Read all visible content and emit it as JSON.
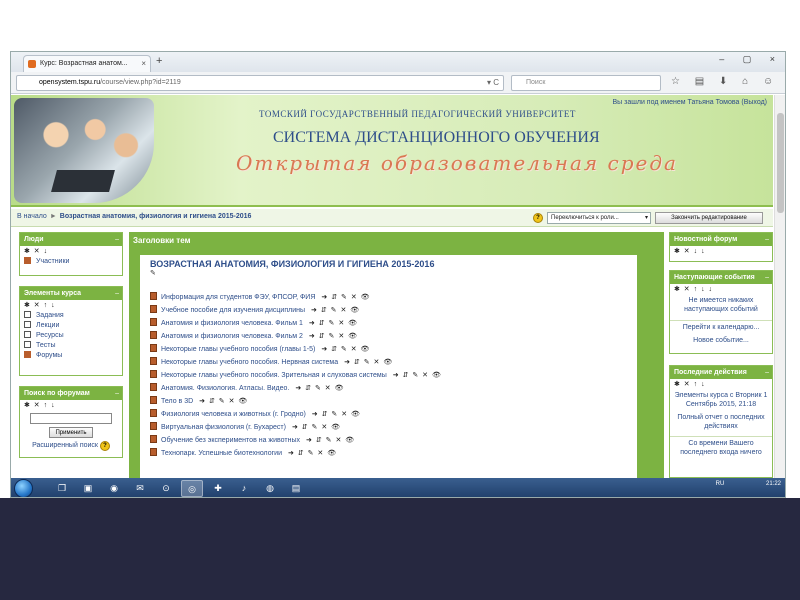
{
  "browser": {
    "tab_title": "Курс: Возрастная анатом...",
    "tab_close": "×",
    "new_tab": "+",
    "window_controls": "– ▢ ×",
    "url_host": "opensystem.tspu.ru",
    "url_path": "/course/view.php?id=2119",
    "url_controls": "▾ C",
    "search_placeholder": "Поиск",
    "toolbar_icons": "☆ ▤ ⬇ ⌂ ☺ ≡"
  },
  "header": {
    "university": "ТОМСКИЙ ГОСУДАРСТВЕННЫЙ ПЕДАГОГИЧЕСКИЙ УНИВЕРСИТЕТ",
    "system": "СИСТЕМА ДИСТАНЦИОННОГО ОБУЧЕНИЯ",
    "slogan": "Открытая образовательная среда",
    "login_prefix": "Вы зашли под именем",
    "user_name": "Татьяна Томова",
    "logout": "(Выход)"
  },
  "breadcrumb": {
    "home": "В начало",
    "separator": "►",
    "current": "Возрастная анатомия, физиология и гигиена 2015-2016"
  },
  "toolbar": {
    "help": "?",
    "role_select": "Переключиться к роли...",
    "role_arrow": "▾",
    "edit_button": "Закончить редактирование"
  },
  "left": {
    "people": {
      "title": "Люди",
      "collapse": "–",
      "controls": "✱ ✕ ↓",
      "items": [
        "Участники"
      ]
    },
    "elements": {
      "title": "Элементы курса",
      "collapse": "–",
      "controls": "✱ ✕ ↑ ↓",
      "items": [
        "Задания",
        "Лекции",
        "Ресурсы",
        "Тесты",
        "Форумы"
      ]
    },
    "forum_search": {
      "title": "Поиск по форумам",
      "collapse": "–",
      "controls": "✱ ✕ ↑ ↓",
      "button": "Применить",
      "advanced": "Расширенный поиск"
    }
  },
  "center": {
    "header": "Заголовки тем",
    "course_title": "ВОЗРАСТНАЯ АНАТОМИЯ, ФИЗИОЛОГИЯ И ГИГИЕНА 2015-2016",
    "edit_mark": "✎",
    "resources": [
      {
        "title": "Информация для студентов ФЭУ, ФПСОР, ФИЯ",
        "controls": "➜ ⇵ ✎ ✕ 👁"
      },
      {
        "title": "Учебное пособие для изучения дисциплины",
        "controls": "➜ ⇵ ✎ ✕ 👁"
      },
      {
        "title": "Анатомия и физиология человека. Фильм 1",
        "controls": "➜ ⇵ ✎ ✕ 👁"
      },
      {
        "title": "Анатомия и физиология человека. Фильм 2",
        "controls": "➜ ⇵ ✎ ✕ 👁"
      },
      {
        "title": "Некоторые главы учебного пособия (главы 1-5)",
        "controls": "➜ ⇵ ✎ ✕ 👁"
      },
      {
        "title": "Некоторые главы учебного пособия. Нервная система",
        "controls": "➜ ⇵ ✎ ✕ 👁"
      },
      {
        "title": "Некоторые главы учебного пособия. Зрительная и слуховая системы",
        "controls": "➜ ⇵ ✎ ✕ 👁"
      },
      {
        "title": "Анатомия. Физиология. Атласы. Видео.",
        "controls": "➜ ⇵ ✎ ✕ 👁"
      },
      {
        "title": "Тело в 3D",
        "controls": "➜ ⇵ ✎ ✕ 👁"
      },
      {
        "title": "Физиология человека и животных (г. Гродно)",
        "controls": "➜ ⇵ ✎ ✕ 👁"
      },
      {
        "title": "Виртуальная физиология (г. Бухарест)",
        "controls": "➜ ⇵ ✎ ✕ 👁"
      },
      {
        "title": "Обучение без экспериментов на животных",
        "controls": "➜ ⇵ ✎ ✕ 👁"
      },
      {
        "title": "Технопарк. Успешные биотехнологии",
        "controls": "➜ ⇵ ✎ ✕ 👁"
      }
    ]
  },
  "right": {
    "news": {
      "title": "Новостной форум",
      "collapse": "–",
      "controls": "✱ ✕ ↓ ↓"
    },
    "upcoming": {
      "title": "Наступающие события",
      "collapse": "–",
      "controls": "✱ ✕ ↑ ↓ ↓",
      "text": "Не имеется никаких наступающих событий",
      "link1": "Перейти к календарю...",
      "link2": "Новое событие..."
    },
    "recent": {
      "title": "Последние действия",
      "collapse": "–",
      "controls": "✱ ✕ ↑ ↓",
      "text1": "Элементы курса с Вторник 1 Сентябрь 2015, 21:18",
      "text2": "Полный отчет о последних действиях",
      "text3": "Со времени Вашего последнего входа ничего"
    }
  },
  "taskbar": {
    "apps": [
      "❐",
      "▣",
      "◉",
      "✉",
      "⊙",
      "◎",
      "✚",
      "♪",
      "◍",
      "▤"
    ],
    "lang": "RU",
    "clock": "21:22"
  },
  "colors": {
    "header_green": "#7cb342",
    "link_blue": "#2e4e8a",
    "slide_dark": "#262840"
  }
}
